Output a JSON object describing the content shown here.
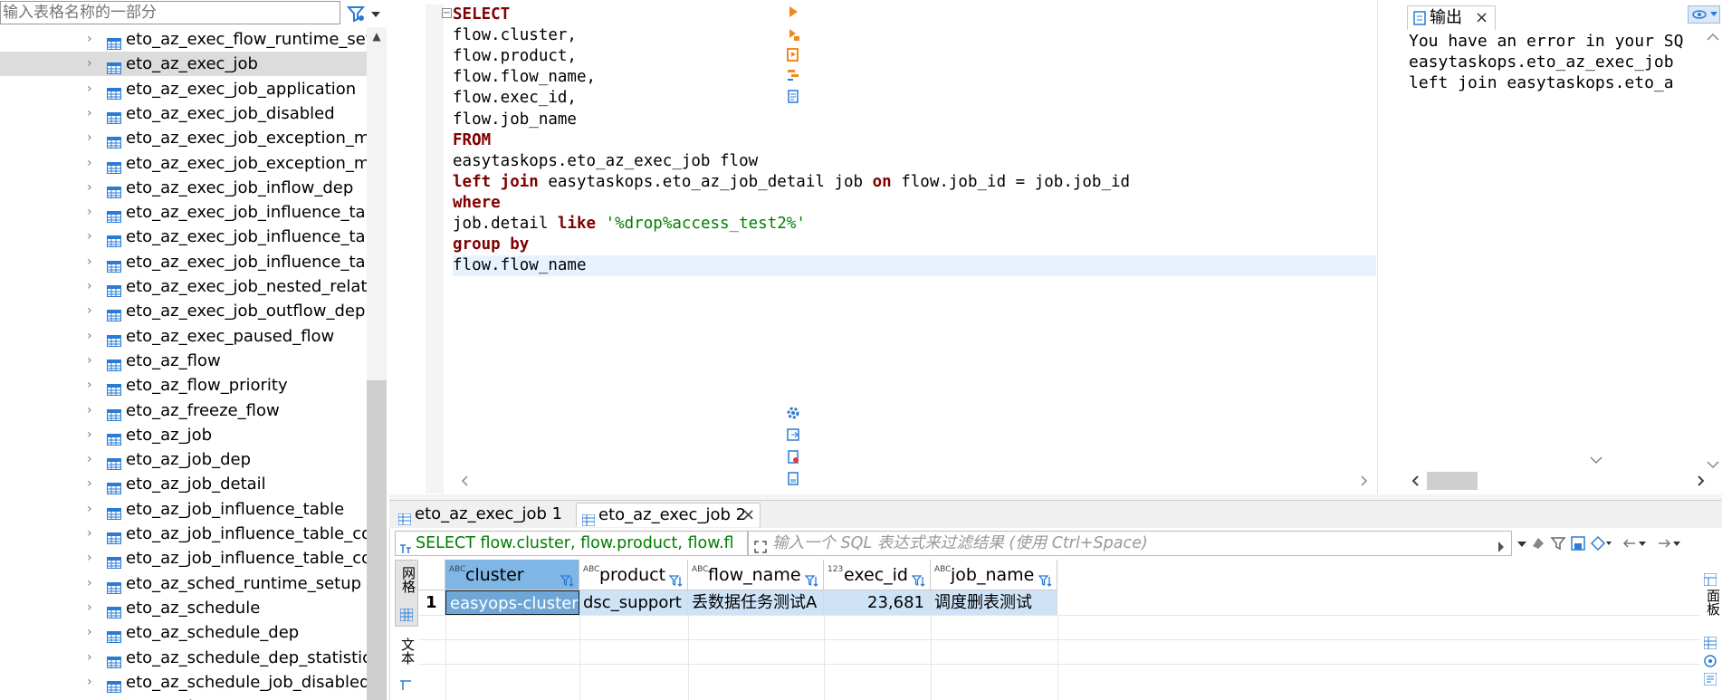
{
  "navigator": {
    "filter_placeholder": "输入表格名称的一部分",
    "items": [
      {
        "label": "eto_az_exec_flow_runtime_setu",
        "selected": false
      },
      {
        "label": "eto_az_exec_job",
        "selected": true
      },
      {
        "label": "eto_az_exec_job_application",
        "selected": false
      },
      {
        "label": "eto_az_exec_job_disabled",
        "selected": false
      },
      {
        "label": "eto_az_exec_job_exception_ms",
        "selected": false
      },
      {
        "label": "eto_az_exec_job_exception_ms",
        "selected": false
      },
      {
        "label": "eto_az_exec_job_inflow_dep",
        "selected": false
      },
      {
        "label": "eto_az_exec_job_influence_tabl",
        "selected": false
      },
      {
        "label": "eto_az_exec_job_influence_tabl",
        "selected": false
      },
      {
        "label": "eto_az_exec_job_influence_tabl",
        "selected": false
      },
      {
        "label": "eto_az_exec_job_nested_relatic",
        "selected": false
      },
      {
        "label": "eto_az_exec_job_outflow_dep",
        "selected": false
      },
      {
        "label": "eto_az_exec_paused_flow",
        "selected": false
      },
      {
        "label": "eto_az_flow",
        "selected": false
      },
      {
        "label": "eto_az_flow_priority",
        "selected": false
      },
      {
        "label": "eto_az_freeze_flow",
        "selected": false
      },
      {
        "label": "eto_az_job",
        "selected": false
      },
      {
        "label": "eto_az_job_dep",
        "selected": false
      },
      {
        "label": "eto_az_job_detail",
        "selected": false
      },
      {
        "label": "eto_az_job_influence_table",
        "selected": false
      },
      {
        "label": "eto_az_job_influence_table_cor",
        "selected": false
      },
      {
        "label": "eto_az_job_influence_table_cor",
        "selected": false
      },
      {
        "label": "eto_az_sched_runtime_setup",
        "selected": false
      },
      {
        "label": "eto_az_schedule",
        "selected": false
      },
      {
        "label": "eto_az_schedule_dep",
        "selected": false
      },
      {
        "label": "eto_az_schedule_dep_statistic",
        "selected": false
      },
      {
        "label": "eto_az_schedule_job_disabled",
        "selected": false
      },
      {
        "label": "eto_cache",
        "selected": false
      }
    ]
  },
  "editor": {
    "lines": [
      [
        {
          "t": "SELECT",
          "c": "kw2"
        }
      ],
      [
        {
          "t": "flow.cluster,",
          "c": ""
        }
      ],
      [
        {
          "t": "flow.product,",
          "c": ""
        }
      ],
      [
        {
          "t": "flow.flow_name,",
          "c": ""
        }
      ],
      [
        {
          "t": "flow.exec_id,",
          "c": ""
        }
      ],
      [
        {
          "t": "flow.job_name",
          "c": ""
        }
      ],
      [
        {
          "t": "FROM",
          "c": "kw2"
        }
      ],
      [
        {
          "t": "easytaskops.eto_az_exec_job flow",
          "c": ""
        }
      ],
      [
        {
          "t": "left join",
          "c": "kw2"
        },
        {
          "t": " easytaskops.eto_az_job_detail job ",
          "c": ""
        },
        {
          "t": "on",
          "c": "kw2"
        },
        {
          "t": " flow.job_id = job.job_id",
          "c": ""
        }
      ],
      [
        {
          "t": "where",
          "c": "kw2"
        }
      ],
      [
        {
          "t": "job.detail ",
          "c": ""
        },
        {
          "t": "like",
          "c": "kw2"
        },
        {
          "t": " ",
          "c": ""
        },
        {
          "t": "'%drop%access_test2%'",
          "c": "str"
        }
      ],
      [
        {
          "t": "group by",
          "c": "kw2"
        }
      ],
      [
        {
          "t": "flow.flow_name",
          "c": ""
        }
      ]
    ]
  },
  "output": {
    "tab_label": "输出",
    "lines": [
      "You have an error in your SQ",
      "easytaskops.eto_az_exec_job",
      "left join easytaskops.eto_a"
    ]
  },
  "results": {
    "tabs": [
      {
        "label": "eto_az_exec_job 1",
        "active": false
      },
      {
        "label": "eto_az_exec_job 2",
        "active": true
      }
    ],
    "sql_preview": "SELECT flow.cluster, flow.product, flow.fl",
    "filter_placeholder": "输入一个 SQL 表达式来过滤结果 (使用 Ctrl+Space)",
    "side_labels": {
      "grid": "网格",
      "text": "文本"
    },
    "right_label": "面板",
    "columns": [
      {
        "name": "cluster",
        "type": "ABC"
      },
      {
        "name": "product",
        "type": "ABC"
      },
      {
        "name": "flow_name",
        "type": "ABC"
      },
      {
        "name": "exec_id",
        "type": "123"
      },
      {
        "name": "job_name",
        "type": "ABC"
      }
    ],
    "rows": [
      {
        "num": "1",
        "cells": [
          "easyops-cluster",
          "dsc_support",
          "丢数据任务测试A",
          "23,681",
          "调度删表测试"
        ]
      }
    ]
  }
}
